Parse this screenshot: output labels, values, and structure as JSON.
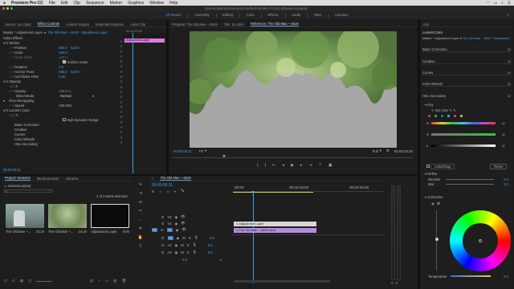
{
  "menubar": {
    "app": "Premiere Pro CC",
    "items": [
      "File",
      "Edit",
      "Clip",
      "Sequence",
      "Marker",
      "Graphics",
      "Window",
      "Help"
    ]
  },
  "title": "/Users/Justin/Documents/Adobe/Premiere Pro/11.0/Seasons.prproj *",
  "workspace_tabs": [
    {
      "label": "All Panels",
      "active": true
    },
    {
      "label": "Assembly",
      "active": false
    },
    {
      "label": "Editing",
      "active": false
    },
    {
      "label": "Color",
      "active": false
    },
    {
      "label": "Effects",
      "active": false
    },
    {
      "label": "Audio",
      "active": false
    },
    {
      "label": "Titles",
      "active": false
    },
    {
      "label": "Libraries",
      "active": false
    }
  ],
  "effect_controls": {
    "tabs": [
      "Source: (no clips)",
      "Effect Controls",
      "Lumetri Scopes",
      "Essential Graphics",
      "Audio Clip"
    ],
    "master_label": "Master * Adjustment Layer",
    "clip_label": "The Old Man ~ 6619 * Adjustment Layer",
    "mini_timecode": "00:00:15:00",
    "clip_block": "Adjustment Layer",
    "video_effects": "Video Effects",
    "motion": "Motion",
    "position_label": "Position",
    "position_x": "960.0",
    "position_y": "540.0",
    "scale_label": "Scale",
    "scale_val": "100.0",
    "scale_width_label": "Scale Width",
    "scale_width_val": "100.0",
    "uniform_scale": "Uniform Scale",
    "rotation_label": "Rotation",
    "rotation_val": "0.0",
    "anchor_label": "Anchor Point",
    "anchor_x": "960.0",
    "anchor_y": "540.0",
    "antiflicker_label": "Anti-flicker Filter",
    "antiflicker_val": "0.00",
    "opacity_section": "Opacity",
    "opacity_label": "Opacity",
    "opacity_val": "100.0 %",
    "blend_label": "Blend Mode",
    "blend_val": "Normal",
    "time_remap": "Time Remapping",
    "speed_label": "Speed",
    "speed_val": "100.00%",
    "lumetri": "Lumetri Color",
    "hdr_label": "High Dynamic Range",
    "basic": "Basic Correction",
    "creative": "Creative",
    "curves": "Curves",
    "color_wheels": "Color Wheels",
    "hsl": "HSL Secondary",
    "timecode": "00:00:05:11"
  },
  "monitor": {
    "tabs": [
      "Program: The Old Man ~ 6619",
      "Title: (no title)",
      "Reference: The Old Man ~ 6619"
    ],
    "timecode": "00:00:05:11",
    "fit": "Fit",
    "quality": "Full",
    "duration": "00:00:24:20"
  },
  "project": {
    "tabs": [
      "Project: Seasons",
      "Media Browser",
      "Libraries"
    ],
    "project_file": "Seasons.prproj",
    "selection": "1 of 3 items selected",
    "items": [
      {
        "name": "The Old Man ~...",
        "duration": "24:20"
      },
      {
        "name": "The Old Man ~...",
        "duration": "24:20"
      },
      {
        "name": "Adjustment Layer",
        "duration": "5:00"
      }
    ]
  },
  "timeline": {
    "tab": "The Old Man ~ 6619",
    "timecode": "00:00:05:11",
    "ruler": [
      "00:00",
      "00:00:15:00",
      "00:00:30:00"
    ],
    "tracks": [
      "V3",
      "V2",
      "V1",
      "A1",
      "A2",
      "A3"
    ],
    "clips": [
      {
        "label": "Adjustment Layer",
        "track": "V2"
      },
      {
        "label": "The Old Man ~ 6619.mp4",
        "track": "V1"
      }
    ],
    "audio_vals": [
      "0.0",
      "0.0",
      "0.0"
    ],
    "master_val": "0.0"
  },
  "lumetri": {
    "tabs": [
      "Info",
      "Lumetri Color"
    ],
    "master_label": "Master * Adjustment Layer",
    "clip_label": "The Old Man ~ 6619 * Adjustment...",
    "sections": [
      "Basic Correction",
      "Creative",
      "Curves",
      "Color Wheels",
      "HSL Secondary"
    ],
    "key": "Key",
    "set_color": "Set color",
    "hsl_rows": [
      "H",
      "S",
      "L"
    ],
    "color_gray": "Color/Gray",
    "reset": "Reset",
    "refine": "Refine",
    "denoise_label": "Denoise",
    "denoise_val": "0.0",
    "blur_label": "Blur",
    "blur_val": "0.0",
    "correction": "Correction",
    "temperature_label": "Temperature",
    "temperature_val": "0.0"
  }
}
